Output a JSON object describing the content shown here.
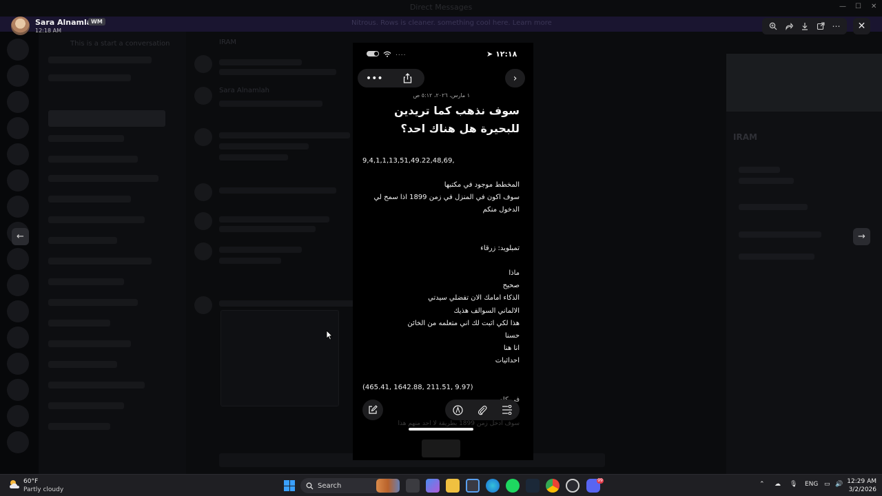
{
  "window": {
    "title": "Direct Messages"
  },
  "background": {
    "banner_text": "Nitrous. Rows is cleaner. something cool here. Learn more",
    "channel_heading": "This is a start a conversation",
    "chat_user": "IRAM",
    "chat_sender": "Sara Alnamlah",
    "profile_name": "IRAM"
  },
  "viewer": {
    "user_name": "Sara Alnamlah",
    "user_tag": "WM",
    "timestamp": "12:18 AM",
    "controls": [
      "zoom-in",
      "forward",
      "download",
      "open-external",
      "more"
    ],
    "close": "✕"
  },
  "phone": {
    "status_time": "١٢:١٨",
    "note_date": "١ مارس، ٢٠٢٦، ٥:١٢ ص",
    "note_title": "سوف نذهب كما تريدين للبحيرة هل هناك احد؟",
    "numbers_line": "9,4,1,1,13,51,49.22,48,69,",
    "para1": [
      "المخطط موجود في مكتبها",
      "سوف اكون في المنزل في زمن 1899 اذا سمح لي",
      "الدخول منكم"
    ],
    "tamblued": "تمبلويد: زرقاء",
    "list": [
      "ماذا",
      "صحيح",
      "الذكاء امامك الان تفضلي سيدتي",
      "الالماني السوالف هذيك",
      "هذا لكي اثبت لك اني متعلمه من الخائن",
      "حسنا",
      "انا هنا",
      "احداثيات"
    ],
    "coords": "(465.41, 1642.88, 211.51, 9.97)",
    "partial_line": "في كام",
    "under_line": "سوف ادخل زمن 1899 بطريقة لا احد منهم هذا"
  },
  "taskbar": {
    "weather_temp": "60°F",
    "weather_desc": "Partly cloudy",
    "search_label": "Search",
    "lang": "ENG",
    "time": "12:29 AM",
    "date": "3/2/2026",
    "discord_badge": "99"
  }
}
